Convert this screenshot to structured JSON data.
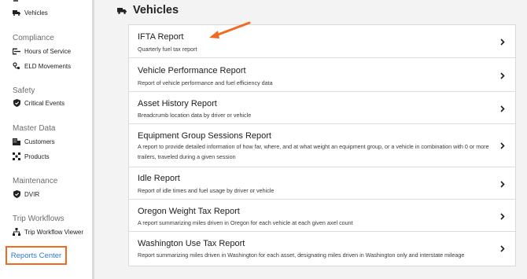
{
  "sidebar": {
    "top_item": {
      "label": "Vehicles",
      "icon": "truck-icon"
    },
    "sections": [
      {
        "title": "Compliance",
        "items": [
          {
            "label": "Hours of Service",
            "icon": "hos-icon"
          },
          {
            "label": "ELD Movements",
            "icon": "movements-icon"
          }
        ]
      },
      {
        "title": "Safety",
        "items": [
          {
            "label": "Critical Events",
            "icon": "shield-icon"
          }
        ]
      },
      {
        "title": "Master Data",
        "items": [
          {
            "label": "Customers",
            "icon": "building-icon"
          },
          {
            "label": "Products",
            "icon": "products-icon"
          }
        ]
      },
      {
        "title": "Maintenance",
        "items": [
          {
            "label": "DVIR",
            "icon": "shield-icon"
          }
        ]
      },
      {
        "title": "Trip Workflows",
        "items": [
          {
            "label": "Trip Workflow Viewer",
            "icon": "workflow-icon"
          }
        ]
      }
    ],
    "reports_center": {
      "label": "Reports Center",
      "highlight_color": "#f26a22",
      "link_color": "#2f78d6"
    }
  },
  "header": {
    "title": "Vehicles",
    "icon": "truck-icon"
  },
  "reports": [
    {
      "name": "IFTA Report",
      "description": "Quarterly fuel tax report"
    },
    {
      "name": "Vehicle Performance Report",
      "description": "Report of vehicle performance and fuel efficiency data"
    },
    {
      "name": "Asset History Report",
      "description": "Breadcrumb location data by driver or vehicle"
    },
    {
      "name": "Equipment Group Sessions Report",
      "description": "A report to provide detailed information of how far, where, and at what weight an equipment group, or a vehicle in combination with 0 or more trailers, traveled during a given session"
    },
    {
      "name": "Idle Report",
      "description": "Report of idle times and fuel usage by driver or vehicle"
    },
    {
      "name": "Oregon Weight Tax Report",
      "description": "A report summarizing miles driven in Oregon for each vehicle at each given axel count"
    },
    {
      "name": "Washington Use Tax Report",
      "description": "Report summarizing miles driven in Washington for each asset, designating miles driven in Washington only and interstate mileage"
    }
  ],
  "annotation": {
    "arrow_color": "#f26a22",
    "points_to": "IFTA Report"
  }
}
